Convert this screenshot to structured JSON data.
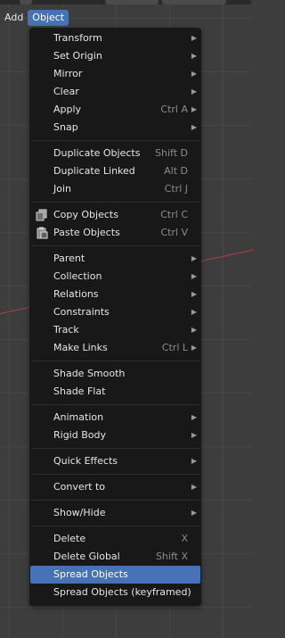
{
  "header": {
    "add_label": "Add",
    "object_label": "Object"
  },
  "menu": {
    "items": [
      {
        "label": "Transform",
        "submenu": true
      },
      {
        "label": "Set Origin",
        "submenu": true
      },
      {
        "label": "Mirror",
        "submenu": true
      },
      {
        "label": "Clear",
        "submenu": true
      },
      {
        "label": "Apply",
        "shortcut": "Ctrl A",
        "submenu": true
      },
      {
        "label": "Snap",
        "submenu": true
      },
      {
        "label": "Duplicate Objects",
        "shortcut": "Shift D"
      },
      {
        "label": "Duplicate Linked",
        "shortcut": "Alt D"
      },
      {
        "label": "Join",
        "shortcut": "Ctrl J"
      },
      {
        "label": "Copy Objects",
        "shortcut": "Ctrl C",
        "icon": "copy-icon"
      },
      {
        "label": "Paste Objects",
        "shortcut": "Ctrl V",
        "icon": "paste-icon"
      },
      {
        "label": "Parent",
        "submenu": true
      },
      {
        "label": "Collection",
        "submenu": true
      },
      {
        "label": "Relations",
        "submenu": true
      },
      {
        "label": "Constraints",
        "submenu": true
      },
      {
        "label": "Track",
        "submenu": true
      },
      {
        "label": "Make Links",
        "shortcut": "Ctrl L",
        "submenu": true
      },
      {
        "label": "Shade Smooth"
      },
      {
        "label": "Shade Flat"
      },
      {
        "label": "Animation",
        "submenu": true
      },
      {
        "label": "Rigid Body",
        "submenu": true
      },
      {
        "label": "Quick Effects",
        "submenu": true
      },
      {
        "label": "Convert to",
        "submenu": true
      },
      {
        "label": "Show/Hide",
        "submenu": true
      },
      {
        "label": "Delete",
        "shortcut": "X"
      },
      {
        "label": "Delete Global",
        "shortcut": "Shift X"
      },
      {
        "label": "Spread Objects",
        "highlighted": true
      },
      {
        "label": "Spread Objects (keyframed)"
      }
    ],
    "submenu_arrow": "▶"
  },
  "colors": {
    "highlight": "#4772b3",
    "menu_bg": "#181818",
    "viewport_bg": "#3d3d3d"
  }
}
